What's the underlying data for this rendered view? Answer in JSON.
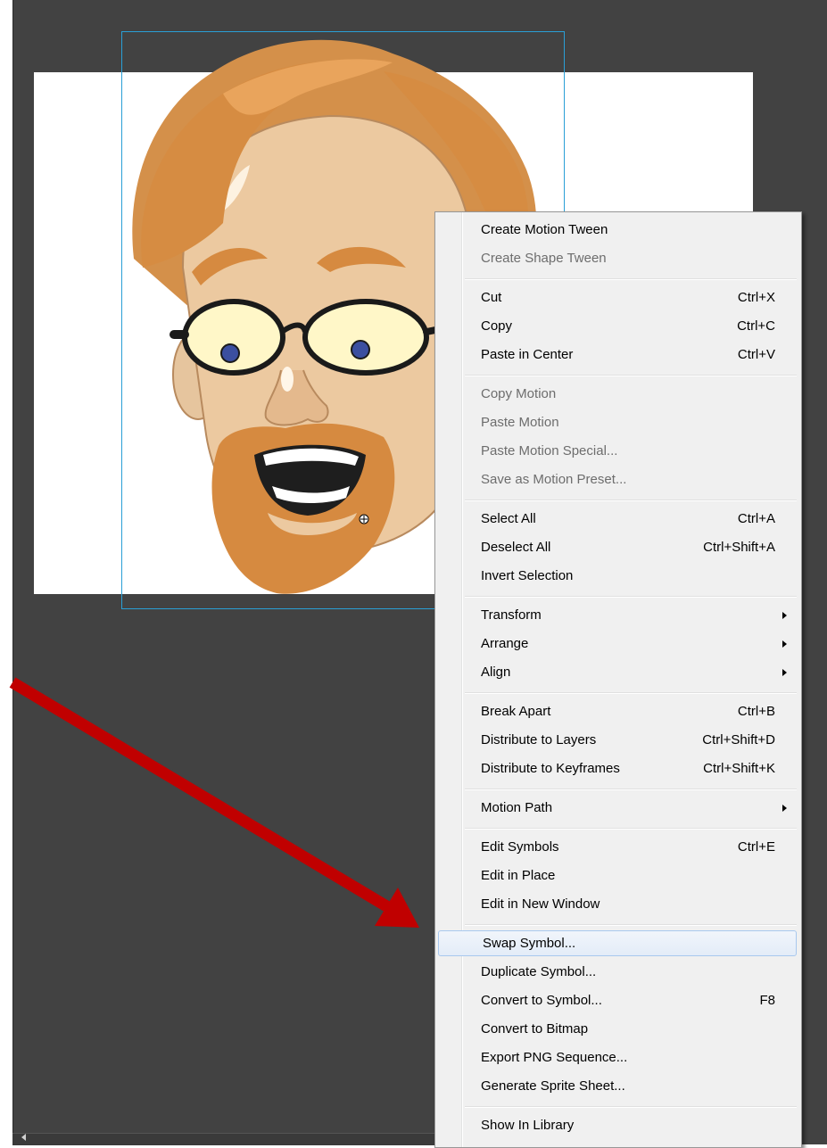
{
  "colors": {
    "workspace": "#424242",
    "stage": "#ffffff",
    "selection": "#2a9fd6",
    "menu_bg": "#f0f0f0",
    "highlight": "#e3ecf8",
    "arrow": "#c00000"
  },
  "context_menu": {
    "items": [
      {
        "label": "Create Motion Tween",
        "shortcut": "",
        "disabled": false
      },
      {
        "label": "Create Shape Tween",
        "shortcut": "",
        "disabled": true
      },
      {
        "label": "Cut",
        "shortcut": "Ctrl+X",
        "disabled": false
      },
      {
        "label": "Copy",
        "shortcut": "Ctrl+C",
        "disabled": false
      },
      {
        "label": "Paste in Center",
        "shortcut": "Ctrl+V",
        "disabled": false
      },
      {
        "label": "Copy Motion",
        "shortcut": "",
        "disabled": true
      },
      {
        "label": "Paste Motion",
        "shortcut": "",
        "disabled": true
      },
      {
        "label": "Paste Motion Special...",
        "shortcut": "",
        "disabled": true
      },
      {
        "label": "Save as Motion Preset...",
        "shortcut": "",
        "disabled": true
      },
      {
        "label": "Select All",
        "shortcut": "Ctrl+A",
        "disabled": false
      },
      {
        "label": "Deselect All",
        "shortcut": "Ctrl+Shift+A",
        "disabled": false
      },
      {
        "label": "Invert Selection",
        "shortcut": "",
        "disabled": false
      },
      {
        "label": "Transform",
        "shortcut": "",
        "submenu": true
      },
      {
        "label": "Arrange",
        "shortcut": "",
        "submenu": true
      },
      {
        "label": "Align",
        "shortcut": "",
        "submenu": true
      },
      {
        "label": "Break Apart",
        "shortcut": "Ctrl+B",
        "disabled": false
      },
      {
        "label": "Distribute to Layers",
        "shortcut": "Ctrl+Shift+D",
        "disabled": false
      },
      {
        "label": "Distribute to Keyframes",
        "shortcut": "Ctrl+Shift+K",
        "disabled": false
      },
      {
        "label": "Motion Path",
        "shortcut": "",
        "submenu": true
      },
      {
        "label": "Edit Symbols",
        "shortcut": "Ctrl+E",
        "disabled": false
      },
      {
        "label": "Edit in Place",
        "shortcut": "",
        "disabled": false
      },
      {
        "label": "Edit in New Window",
        "shortcut": "",
        "disabled": false
      },
      {
        "label": "Swap Symbol...",
        "shortcut": "",
        "highlighted": true
      },
      {
        "label": "Duplicate Symbol...",
        "shortcut": "",
        "disabled": false
      },
      {
        "label": "Convert to Symbol...",
        "shortcut": "F8",
        "disabled": false
      },
      {
        "label": "Convert to Bitmap",
        "shortcut": "",
        "disabled": false
      },
      {
        "label": "Export PNG Sequence...",
        "shortcut": "",
        "disabled": false
      },
      {
        "label": "Generate Sprite Sheet...",
        "shortcut": "",
        "disabled": false
      },
      {
        "label": "Show In Library",
        "shortcut": "",
        "disabled": false
      }
    ]
  }
}
